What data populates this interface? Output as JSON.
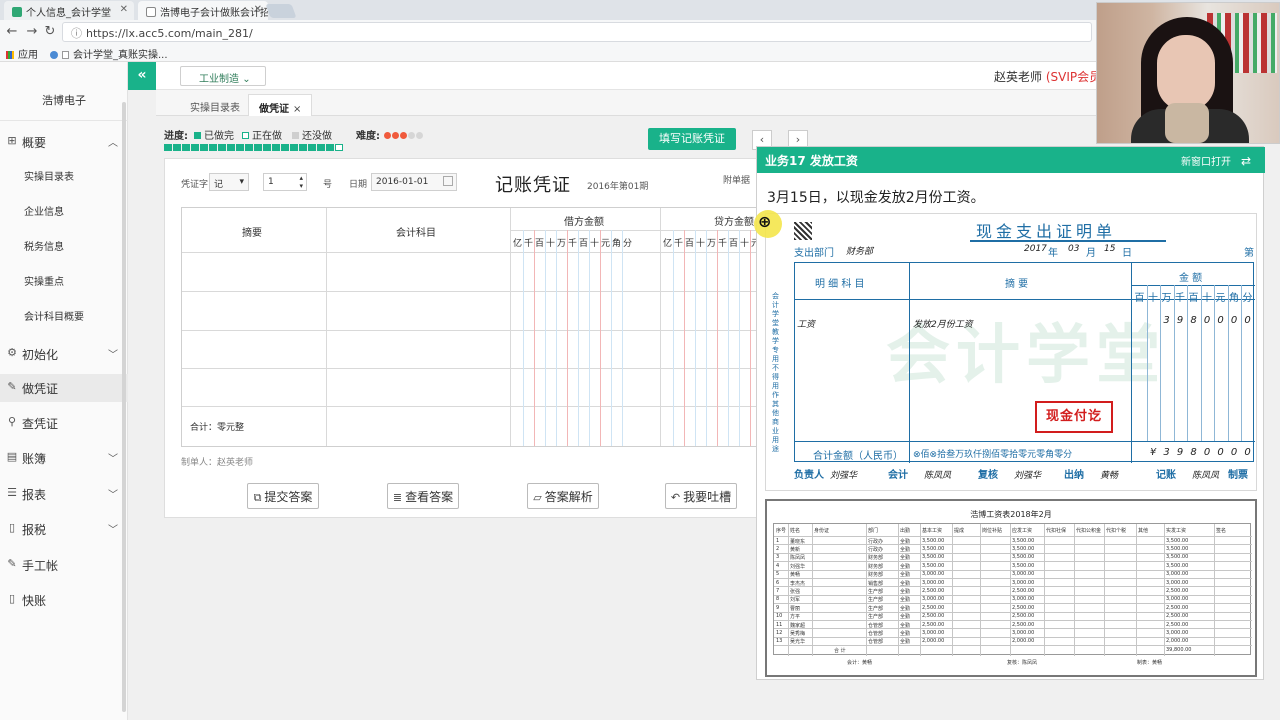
{
  "browser": {
    "tabs": [
      {
        "title": "个人信息_会计学堂",
        "color": "#2fa774"
      },
      {
        "title": "浩博电子会计做账会计招",
        "color": "#888888"
      }
    ],
    "url": "https://lx.acc5.com/main_281/",
    "bookmarks": [
      "应用",
      "会计学堂_真账实操..."
    ]
  },
  "sidebar": {
    "company": "浩博电子",
    "menu": [
      {
        "label": "概要",
        "icon": "grid-icon",
        "chevron": "up"
      },
      {
        "label": "初始化",
        "icon": "gear-icon",
        "chevron": "down"
      },
      {
        "label": "做凭证",
        "icon": "pen-icon",
        "chevron": ""
      },
      {
        "label": "查凭证",
        "icon": "search-icon",
        "chevron": ""
      },
      {
        "label": "账簿",
        "icon": "doc-icon",
        "chevron": "down"
      },
      {
        "label": "报表",
        "icon": "list-icon",
        "chevron": "down"
      },
      {
        "label": "报税",
        "icon": "file-icon",
        "chevron": "down"
      },
      {
        "label": "手工帐",
        "icon": "pen-icon",
        "chevron": ""
      },
      {
        "label": "快账",
        "icon": "file-icon",
        "chevron": ""
      }
    ],
    "submenu": [
      "实操目录表",
      "企业信息",
      "税务信息",
      "实操重点",
      "会计科目概要"
    ]
  },
  "header": {
    "collapse": "«",
    "dept": "工业制造",
    "teacher": "赵英老师",
    "vip": "(SVIP会员"
  },
  "tabs": {
    "catalog": "实操目录表",
    "voucher": "做凭证",
    "close": "×"
  },
  "progress": {
    "label": "进度:",
    "done": "已做完",
    "doing": "正在做",
    "todo": "还没做",
    "difficulty": "难度:",
    "stars_filled": 3,
    "stars_total": 5,
    "segments_done": 19,
    "segments_current": 1,
    "segments_total": 20,
    "fill_button": "填写记账凭证"
  },
  "voucher": {
    "type_label": "凭证字",
    "type_value": "记",
    "number_value": "1",
    "number_suffix": "号",
    "date_label": "日期",
    "date_value": "2016-01-01",
    "title": "记账凭证",
    "period": "2016年第01期",
    "attachments": "附单据",
    "col_summary": "摘要",
    "col_account": "会计科目",
    "col_debit": "借方金额",
    "col_credit": "贷方金额",
    "digits": [
      "亿",
      "千",
      "百",
      "十",
      "万",
      "千",
      "百",
      "十",
      "元",
      "角",
      "分"
    ],
    "total": "合计：零元整",
    "maker": "制单人：赵英老师",
    "buttons": [
      "提交答案",
      "查看答案",
      "答案解析",
      "我要吐槽"
    ]
  },
  "business": {
    "title": "业务17 发放工资",
    "new_window": "新窗口打开",
    "description": "3月15日，以现金发放2月份工资。",
    "certificate": {
      "title": "现金支出证明单",
      "dept_label": "支出部门",
      "dept_value": "财务部",
      "year": "2017",
      "year_suffix": "年",
      "month": "03",
      "month_suffix": "月",
      "day": "15",
      "day_suffix": "日",
      "page_mark": "第",
      "col_item": "明 细 科 目",
      "col_summary": "摘 要",
      "col_amount": "金 额",
      "digits": [
        "百",
        "十",
        "万",
        "千",
        "百",
        "十",
        "元",
        "角",
        "分"
      ],
      "row_item": "工资",
      "row_summary": "发放2月份工资",
      "row_amount": [
        "",
        "",
        "3",
        "9",
        "8",
        "0",
        "0",
        "0",
        "0"
      ],
      "total_label": "合计金额（人民币）",
      "total_words": "⊗佰⊗拾叁万玖仟捌佰零拾零元零角零分",
      "total_amount": [
        "¥",
        "3",
        "9",
        "8",
        "0",
        "0",
        "0",
        "0"
      ],
      "stamp": "现金付讫",
      "side_note": "会计学堂教学专用 不得用作其他商业用途",
      "watermark": "会计学堂",
      "signers": [
        {
          "label": "负责人",
          "name": "刘强华"
        },
        {
          "label": "会计",
          "name": "陈凤凤"
        },
        {
          "label": "复核",
          "name": "刘强华"
        },
        {
          "label": "出纳",
          "name": "黄畅"
        },
        {
          "label": "记账",
          "name": "陈凤凤"
        },
        {
          "label": "制票",
          "name": ""
        }
      ]
    },
    "payroll": {
      "title": "浩博工资表2018年2月",
      "headers": [
        "序号",
        "姓名",
        "身份证",
        "部门",
        "出勤",
        "基本工资",
        "提成",
        "岗位补贴",
        "应发工资",
        "代扣社保",
        "代扣公积金",
        "代扣个税",
        "其他",
        "实发工资",
        "签名"
      ],
      "rows": [
        [
          "1",
          "董晓东",
          "",
          "行政办",
          "全勤",
          "3,500.00",
          "",
          "",
          "3,500.00",
          "",
          "",
          "",
          "",
          "3,500.00",
          ""
        ],
        [
          "2",
          "黄新",
          "",
          "行政办",
          "全勤",
          "3,500.00",
          "",
          "",
          "3,500.00",
          "",
          "",
          "",
          "",
          "3,500.00",
          ""
        ],
        [
          "3",
          "陈凤凤",
          "",
          "财务部",
          "全勤",
          "3,500.00",
          "",
          "",
          "3,500.00",
          "",
          "",
          "",
          "",
          "3,500.00",
          ""
        ],
        [
          "4",
          "刘强华",
          "",
          "财务部",
          "全勤",
          "3,500.00",
          "",
          "",
          "3,500.00",
          "",
          "",
          "",
          "",
          "3,500.00",
          ""
        ],
        [
          "5",
          "黄畅",
          "",
          "财务部",
          "全勤",
          "3,000.00",
          "",
          "",
          "3,000.00",
          "",
          "",
          "",
          "",
          "3,000.00",
          ""
        ],
        [
          "6",
          "李杰杰",
          "",
          "销售部",
          "全勤",
          "3,000.00",
          "",
          "",
          "3,000.00",
          "",
          "",
          "",
          "",
          "3,000.00",
          ""
        ],
        [
          "7",
          "张强",
          "",
          "生产部",
          "全勤",
          "2,500.00",
          "",
          "",
          "2,500.00",
          "",
          "",
          "",
          "",
          "2,500.00",
          ""
        ],
        [
          "8",
          "刘军",
          "",
          "生产部",
          "全勤",
          "3,000.00",
          "",
          "",
          "3,000.00",
          "",
          "",
          "",
          "",
          "3,000.00",
          ""
        ],
        [
          "9",
          "曹丽",
          "",
          "生产部",
          "全勤",
          "2,500.00",
          "",
          "",
          "2,500.00",
          "",
          "",
          "",
          "",
          "2,500.00",
          ""
        ],
        [
          "10",
          "方平",
          "",
          "生产部",
          "全勤",
          "2,500.00",
          "",
          "",
          "2,500.00",
          "",
          "",
          "",
          "",
          "2,500.00",
          ""
        ],
        [
          "11",
          "魏家超",
          "",
          "仓管部",
          "全勤",
          "2,500.00",
          "",
          "",
          "2,500.00",
          "",
          "",
          "",
          "",
          "2,500.00",
          ""
        ],
        [
          "12",
          "吴秀梅",
          "",
          "仓管部",
          "全勤",
          "3,000.00",
          "",
          "",
          "3,000.00",
          "",
          "",
          "",
          "",
          "3,000.00",
          ""
        ],
        [
          "13",
          "吴光华",
          "",
          "仓管部",
          "全勤",
          "2,000.00",
          "",
          "",
          "2,000.00",
          "",
          "",
          "",
          "",
          "2,000.00",
          ""
        ]
      ],
      "total_label": "合 计",
      "total_value": "39,800.00",
      "footer": [
        "会计：黄畅",
        "复核：陈凤凤",
        "制表：黄畅"
      ]
    }
  }
}
